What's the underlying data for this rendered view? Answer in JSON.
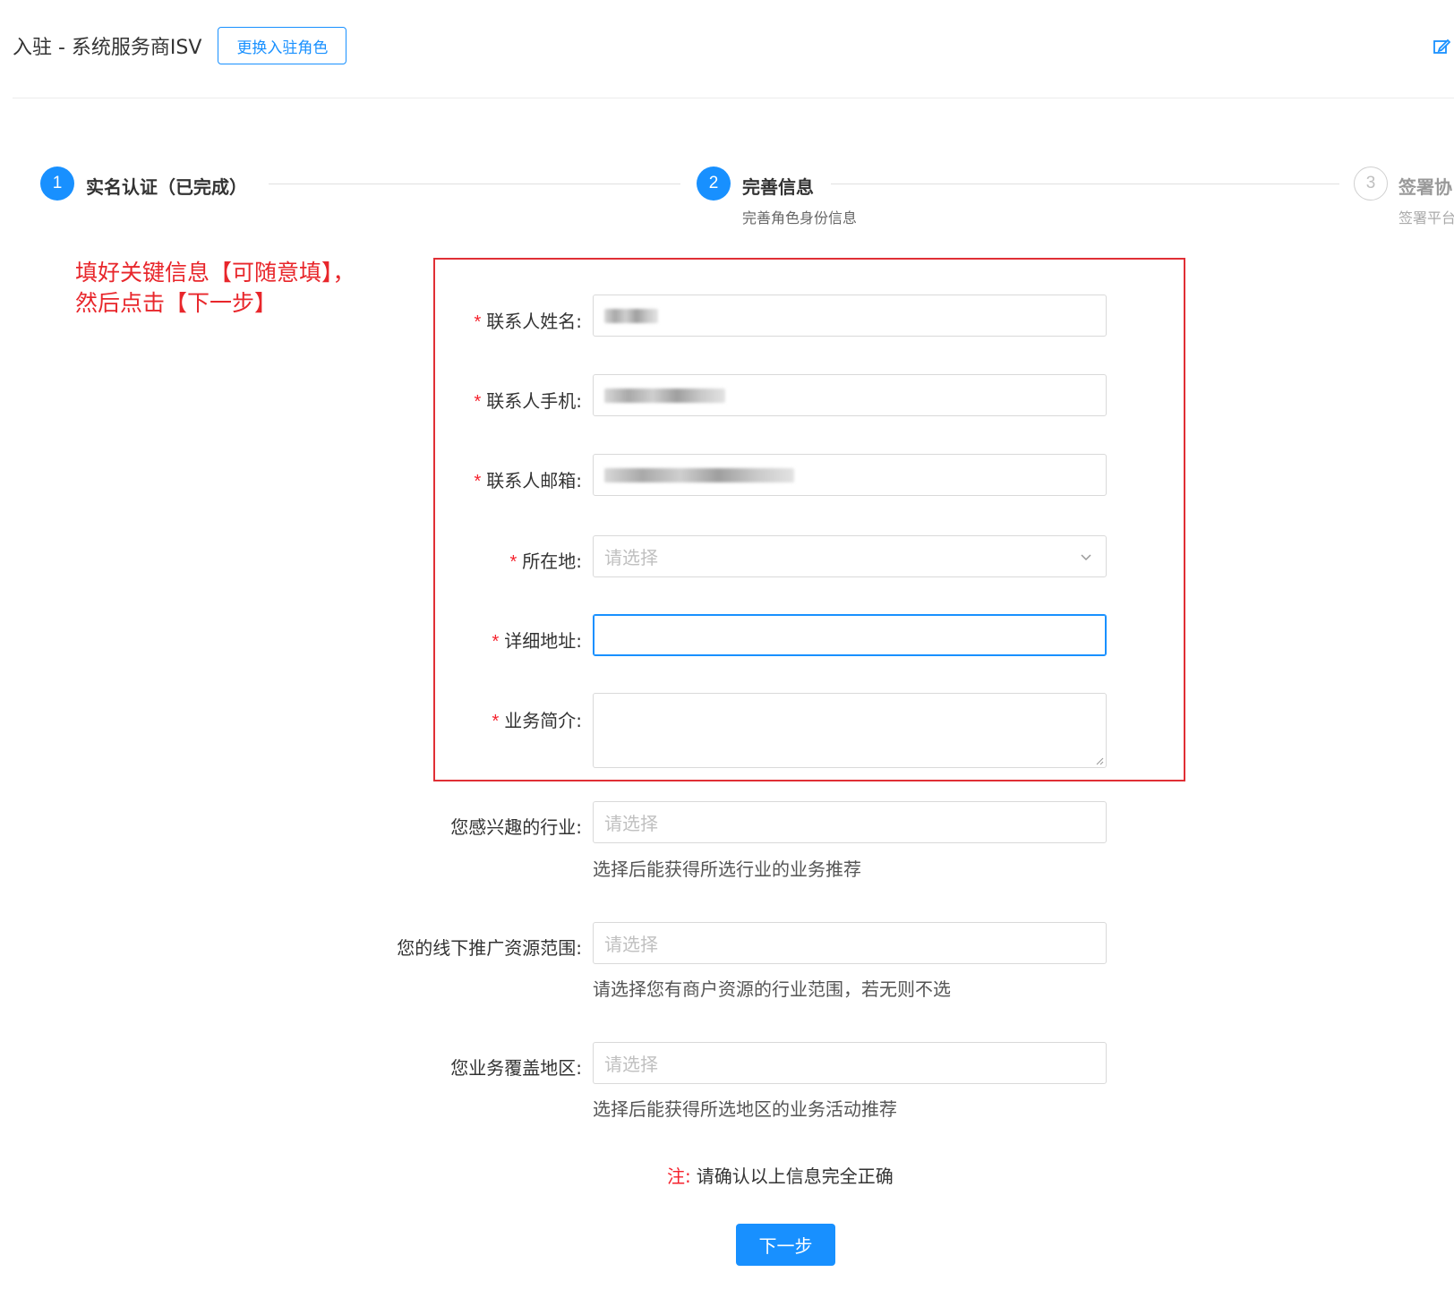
{
  "header": {
    "title": "入驻 - 系统服务商ISV",
    "change_role_label": "更换入驻角色"
  },
  "steps": [
    {
      "number": "1",
      "title": "实名认证（已完成）",
      "description": "",
      "status": "finished"
    },
    {
      "number": "2",
      "title": "完善信息",
      "description": "完善角色身份信息",
      "status": "active"
    },
    {
      "number": "3",
      "title": "签署协",
      "description": "签署平台",
      "status": "wait"
    }
  ],
  "annotation": {
    "line1": "填好关键信息【可随意填】，",
    "line2": "然后点击【下一步】"
  },
  "form": {
    "required_mark": "*",
    "contact_name": {
      "label": "联系人姓名:",
      "value": ""
    },
    "contact_phone": {
      "label": "联系人手机:",
      "value": ""
    },
    "contact_email": {
      "label": "联系人邮箱:",
      "value": ""
    },
    "location": {
      "label": "所在地:",
      "placeholder": "请选择"
    },
    "address": {
      "label": "详细地址:",
      "value": ""
    },
    "business_intro": {
      "label": "业务简介:",
      "value": ""
    },
    "industry": {
      "label": "您感兴趣的行业:",
      "placeholder": "请选择",
      "hint": "选择后能获得所选行业的业务推荐"
    },
    "offline_range": {
      "label": "您的线下推广资源范围:",
      "placeholder": "请选择",
      "hint": "请选择您有商户资源的行业范围，若无则不选"
    },
    "coverage_area": {
      "label": "您业务覆盖地区:",
      "placeholder": "请选择",
      "hint": "选择后能获得所选地区的业务活动推荐"
    }
  },
  "note": {
    "prefix": "注:",
    "text": "请确认以上信息完全正确"
  },
  "next_button_label": "下一步",
  "colors": {
    "primary": "#1890ff",
    "required": "#f5222d",
    "annotation": "#e8262b"
  },
  "icons": {
    "edit": "edit-icon",
    "select_arrow": "chevron-down-icon",
    "resize": "resize-handle-icon"
  }
}
